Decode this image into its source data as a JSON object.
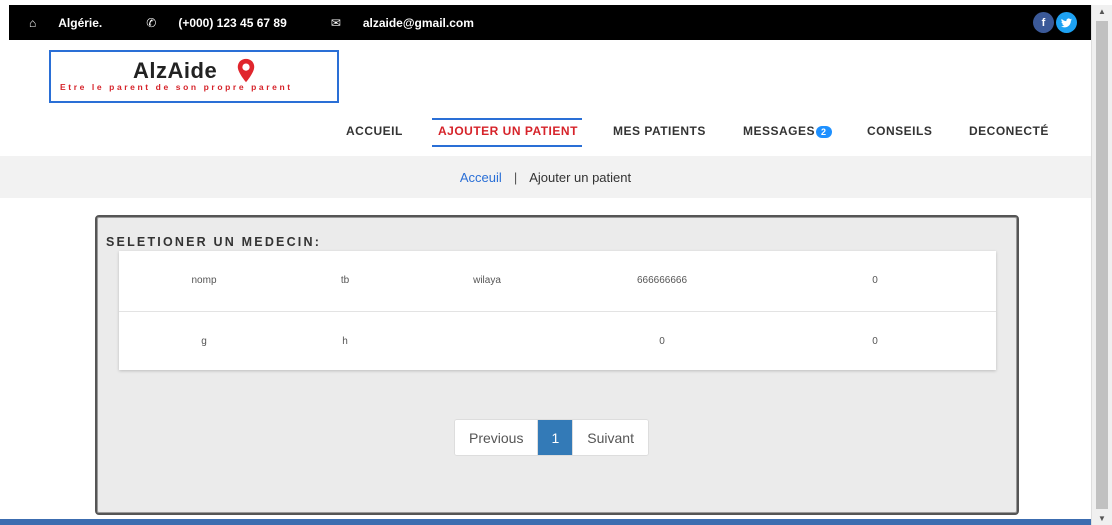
{
  "topbar": {
    "location": "Algérie.",
    "phone": "(+000) 123 45 67 89",
    "email": "alzaide@gmail.com",
    "social": {
      "facebook": "f",
      "twitter": "t"
    }
  },
  "logo": {
    "name": "AlzAide",
    "tagline": "Etre le parent de son propre parent",
    "colors": {
      "border": "#2a6fd6",
      "tagline": "#d6232a",
      "pin": "#e0262d"
    }
  },
  "nav": {
    "items": [
      {
        "label": "ACCUEIL"
      },
      {
        "label": "AJOUTER UN PATIENT",
        "active": true
      },
      {
        "label": "MES PATIENTS"
      },
      {
        "label": "MESSAGES",
        "badge": "2"
      },
      {
        "label": "CONSEILS"
      },
      {
        "label": "DECONECTÉ"
      }
    ]
  },
  "breadcrumb": {
    "home": "Acceuil",
    "separator": "|",
    "current": "Ajouter un patient"
  },
  "panel": {
    "title": "SELETIONER UN MEDECIN:",
    "rows": [
      [
        "nomp",
        "tb",
        "wilaya",
        "666666666",
        "0"
      ],
      [
        "g",
        "h",
        "",
        "0",
        "0"
      ]
    ]
  },
  "pagination": {
    "previous": "Previous",
    "current": "1",
    "next": "Suivant"
  },
  "colors": {
    "topbar": "#000000",
    "accent": "#2a6fd6",
    "active_nav": "#d6232a",
    "pager_active": "#337ab7"
  }
}
